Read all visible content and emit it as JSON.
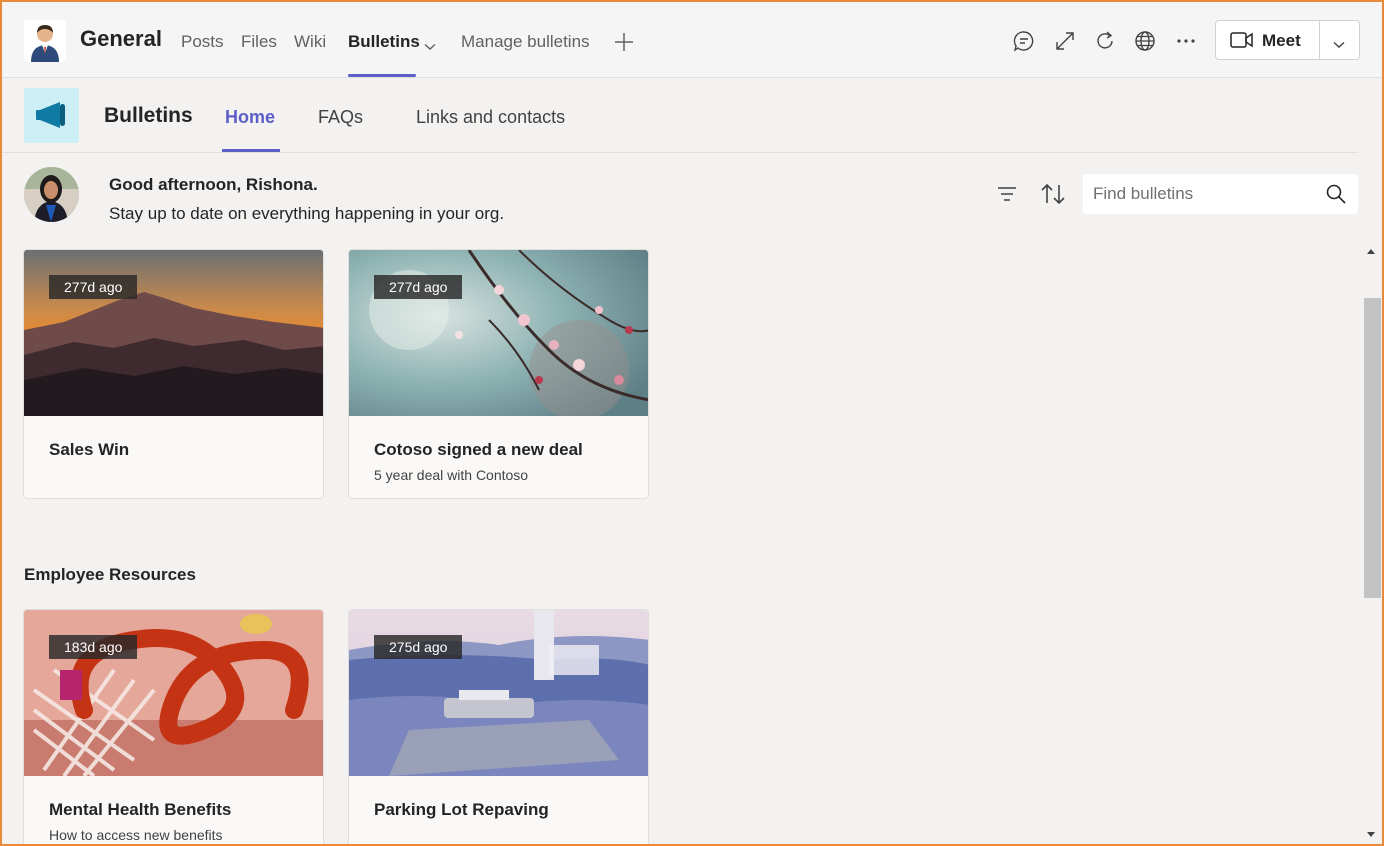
{
  "header": {
    "channel_name": "General",
    "tabs": [
      {
        "label": "Posts"
      },
      {
        "label": "Files"
      },
      {
        "label": "Wiki"
      },
      {
        "label": "Bulletins"
      },
      {
        "label": "Manage bulletins"
      }
    ],
    "active_tab": "Bulletins",
    "meet_label": "Meet",
    "icons": [
      "conversation-icon",
      "expand-icon",
      "refresh-icon",
      "globe-icon",
      "more-icon",
      "video-icon",
      "chevron-down-icon",
      "plus-icon"
    ]
  },
  "app": {
    "name": "Bulletins",
    "tabs": [
      {
        "label": "Home"
      },
      {
        "label": "FAQs"
      },
      {
        "label": "Links and contacts"
      }
    ],
    "active_tab": "Home"
  },
  "greeting": {
    "title": "Good afternoon, Rishona.",
    "subtitle": "Stay up to date on everything happening in your org."
  },
  "search": {
    "placeholder": "Find bulletins"
  },
  "sections": [
    {
      "title": "",
      "cards": [
        {
          "age": "277d ago",
          "title": "Sales Win",
          "subtitle": ""
        },
        {
          "age": "277d ago",
          "title": "Cotoso signed a new deal",
          "subtitle": "5 year deal with Contoso"
        }
      ]
    },
    {
      "title": "Employee Resources",
      "cards": [
        {
          "age": "183d ago",
          "title": "Mental Health Benefits",
          "subtitle": "How to access new benefits"
        },
        {
          "age": "275d ago",
          "title": "Parking Lot Repaving",
          "subtitle": ""
        }
      ]
    }
  ],
  "colors": {
    "accent": "#5b5fc7",
    "frame": "#e8893c",
    "background": "#f3f2f1",
    "app_logo_bg": "#cdeef4",
    "app_logo_fg": "#0f7aa3"
  }
}
